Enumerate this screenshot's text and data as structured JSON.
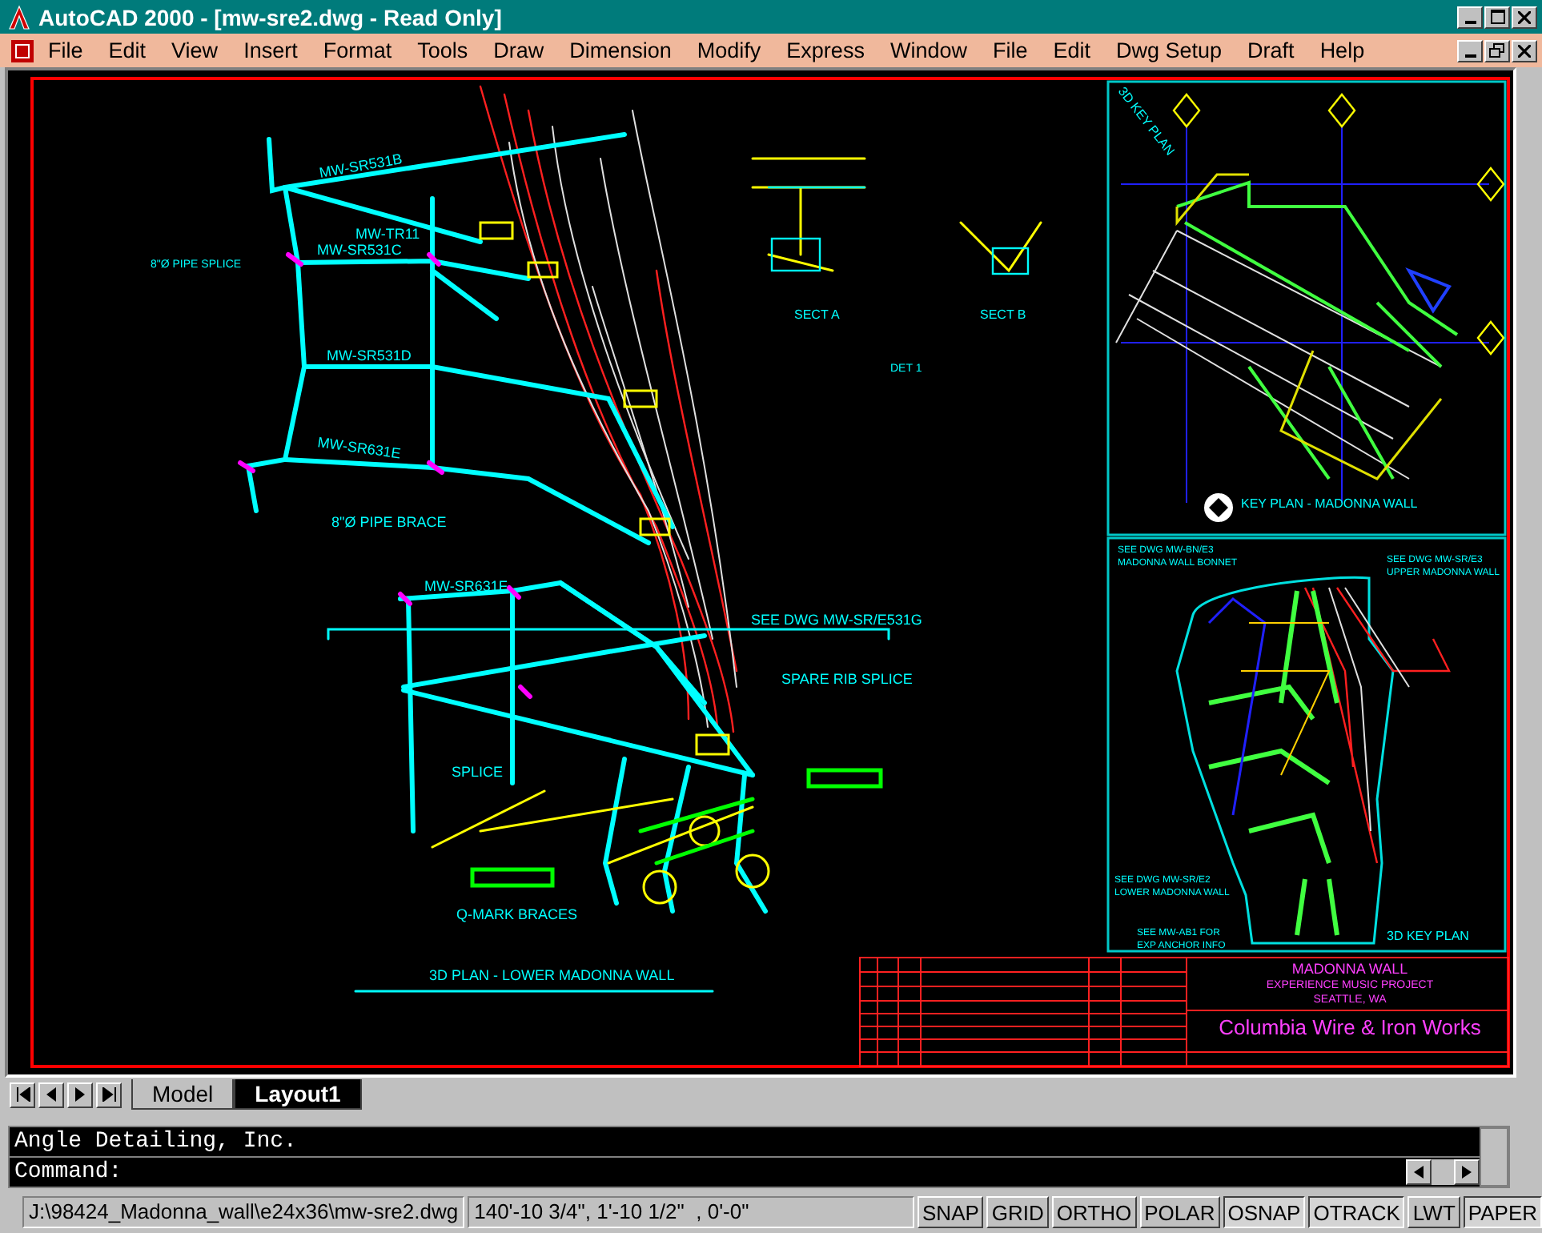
{
  "window": {
    "title": "AutoCAD 2000 - [mw-sre2.dwg - Read Only]"
  },
  "menu": [
    {
      "label": "File"
    },
    {
      "label": "Edit"
    },
    {
      "label": "View"
    },
    {
      "label": "Insert"
    },
    {
      "label": "Format"
    },
    {
      "label": "Tools"
    },
    {
      "label": "Draw"
    },
    {
      "label": "Dimension"
    },
    {
      "label": "Modify"
    },
    {
      "label": "Express"
    },
    {
      "label": "Window"
    },
    {
      "label": "File"
    },
    {
      "label": "Edit"
    },
    {
      "label": "Dwg Setup"
    },
    {
      "label": "Draft"
    },
    {
      "label": "Help"
    }
  ],
  "drawing": {
    "labels": [
      {
        "text": "MW-SR531B"
      },
      {
        "text": "MW-TR11"
      },
      {
        "text": "MW-SR531C"
      },
      {
        "text": "MW-SR531D"
      },
      {
        "text": "MW-SR631E"
      },
      {
        "text": "8\"Ø PIPE SPLICE"
      },
      {
        "text": "8\"Ø PIPE BRACE"
      },
      {
        "text": "MW-SR631F"
      },
      {
        "text": "SEE DWG MW-SR/E531G"
      },
      {
        "text": "SPARE RIB SPLICE"
      },
      {
        "text": "SPLICE"
      },
      {
        "text": "Q-MARK BRACES"
      },
      {
        "text": "3D PLAN - LOWER MADONNA WALL"
      },
      {
        "text": "SECT A"
      },
      {
        "text": "SECT B"
      },
      {
        "text": "DET 1"
      },
      {
        "text": "3D KEY PLAN"
      },
      {
        "text": "KEY PLAN - MADONNA WALL"
      },
      {
        "text": "SEE DWG MW-BN/E3"
      },
      {
        "text": "MADONNA WALL BONNET"
      },
      {
        "text": "SEE DWG MW-SR/E3"
      },
      {
        "text": "UPPER MADONNA WALL"
      },
      {
        "text": "SEE DWG MW-SR/E2"
      },
      {
        "text": "LOWER MADONNA WALL"
      },
      {
        "text": "SEE MW-AB1 FOR"
      },
      {
        "text": "EXP ANCHOR INFO"
      },
      {
        "text": "3D KEY PLAN"
      },
      {
        "text": "MADONNA WALL"
      },
      {
        "text": "EXPERIENCE MUSIC PROJECT"
      },
      {
        "text": "SEATTLE, WA"
      },
      {
        "text": "Columbia Wire & Iron Works"
      }
    ]
  },
  "layout_tabs": [
    {
      "label": "Model",
      "selected": false
    },
    {
      "label": "Layout1",
      "selected": true
    }
  ],
  "command_window": {
    "history": "Angle Detailing, Inc.",
    "prompt": "Command:"
  },
  "status_bar": {
    "path": "J:\\98424_Madonna_wall\\e24x36\\mw-sre2.dwg",
    "coordinates": "140'-10 3/4\", 1'-10 1/2\"  , 0'-0\"",
    "toggles": [
      {
        "label": "SNAP",
        "on": false
      },
      {
        "label": "GRID",
        "on": false
      },
      {
        "label": "ORTHO",
        "on": false
      },
      {
        "label": "POLAR",
        "on": false
      },
      {
        "label": "OSNAP",
        "on": true
      },
      {
        "label": "OTRACK",
        "on": true
      },
      {
        "label": "LWT",
        "on": false
      },
      {
        "label": "PAPER",
        "on": true
      }
    ]
  }
}
